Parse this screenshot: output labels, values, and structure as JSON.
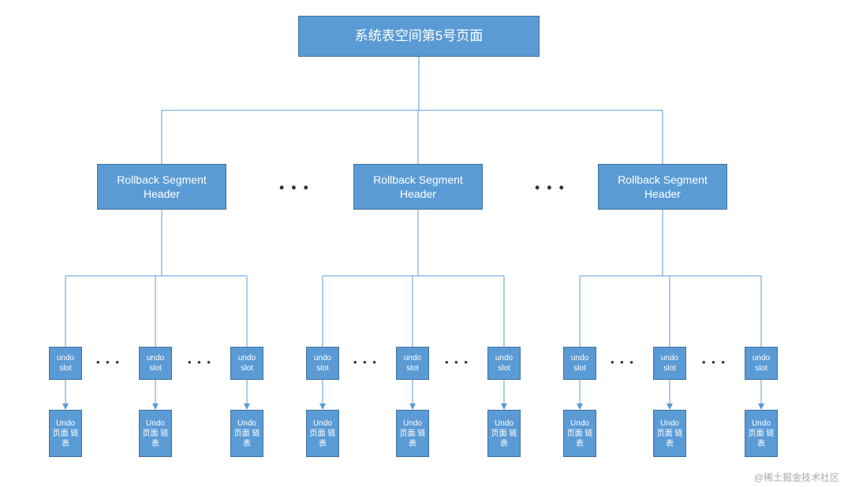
{
  "root": {
    "label": "系统表空间第5号页面"
  },
  "rollbackHeaders": [
    {
      "label": "Rollback Segment Header"
    },
    {
      "label": "Rollback Segment Header"
    },
    {
      "label": "Rollback Segment Header"
    }
  ],
  "columnEllipsis": "• • •",
  "slotEllipsis": "• • •",
  "slots": {
    "group1": [
      {
        "top": "undo slot",
        "bottom": "Undo 页面 链表"
      },
      {
        "top": "undo slot",
        "bottom": "Undo 页面 链表"
      },
      {
        "top": "undo slot",
        "bottom": "Undo 页面 链表"
      }
    ],
    "group2": [
      {
        "top": "undo slot",
        "bottom": "Undo 页面 链表"
      },
      {
        "top": "undo slot",
        "bottom": "Undo 页面 链表"
      },
      {
        "top": "undo slot",
        "bottom": "Undo 页面 链表"
      }
    ],
    "group3": [
      {
        "top": "undo slot",
        "bottom": "Undo 页面 链表"
      },
      {
        "top": "undo slot",
        "bottom": "Undo 页面 链表"
      },
      {
        "top": "undo slot",
        "bottom": "Undo 页面 链表"
      }
    ]
  },
  "watermark": "@稀土掘金技术社区"
}
